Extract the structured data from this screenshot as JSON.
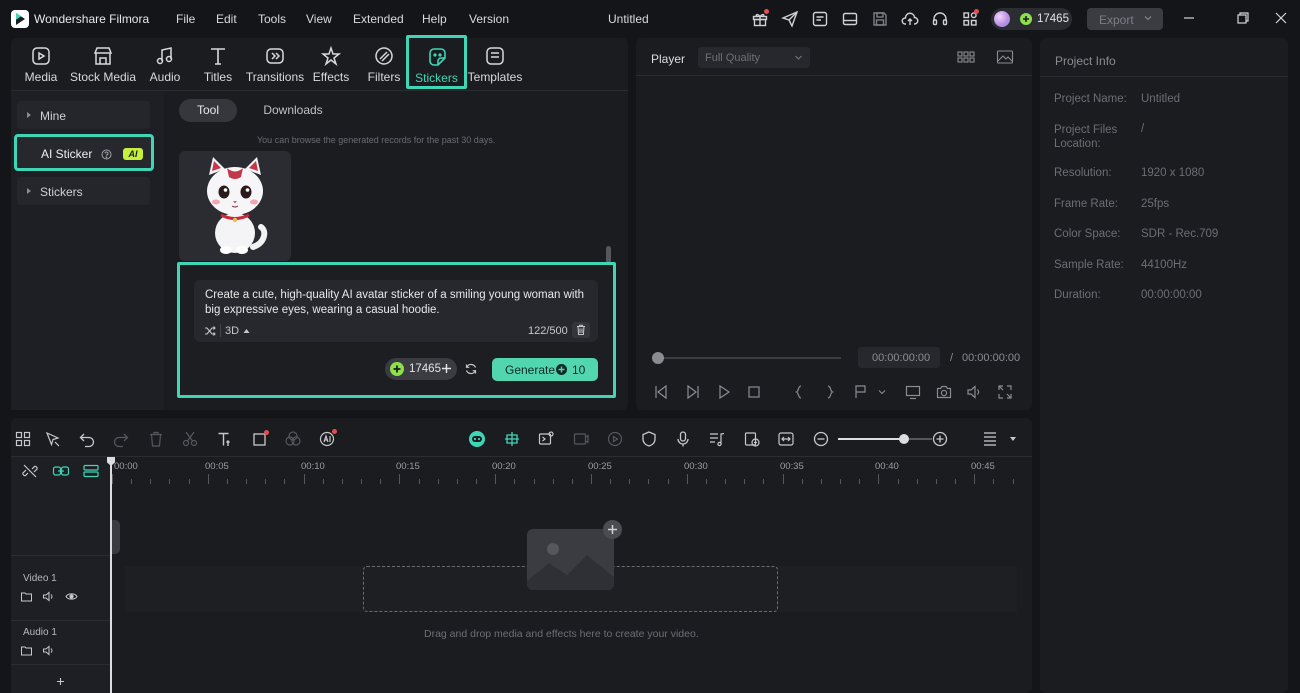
{
  "app": {
    "name": "Wondershare Filmora",
    "document_title": "Untitled"
  },
  "menu": [
    "File",
    "Edit",
    "Tools",
    "View",
    "Extended",
    "Help",
    "Version"
  ],
  "account": {
    "credits": "17465"
  },
  "toolbar": {
    "export_label": "Export"
  },
  "media_tabs": [
    {
      "label": "Media",
      "icon": "media-icon"
    },
    {
      "label": "Stock Media",
      "icon": "stock-media-icon"
    },
    {
      "label": "Audio",
      "icon": "audio-icon"
    },
    {
      "label": "Titles",
      "icon": "titles-icon"
    },
    {
      "label": "Transitions",
      "icon": "transitions-icon"
    },
    {
      "label": "Effects",
      "icon": "effects-icon"
    },
    {
      "label": "Filters",
      "icon": "filters-icon"
    },
    {
      "label": "Stickers",
      "icon": "stickers-icon",
      "active": true
    },
    {
      "label": "Templates",
      "icon": "templates-icon"
    }
  ],
  "sidebar": {
    "items": [
      {
        "label": "Mine"
      },
      {
        "label": "AI Sticker",
        "badge": "AI",
        "active": true
      },
      {
        "label": "Stickers"
      }
    ]
  },
  "sticker_panel": {
    "tabs": [
      "Tool",
      "Downloads"
    ],
    "active_tab": "Tool",
    "notice": "You can browse the generated records for the past 30 days.",
    "prompt_text": "Create a cute, high-quality AI avatar sticker of a smiling young woman with big expressive eyes, wearing a casual hoodie.",
    "style": "3D",
    "char_count": "122/500",
    "credits": "17465",
    "generate_label": "Generate",
    "generate_cost": "10"
  },
  "player": {
    "label": "Player",
    "quality": "Full Quality",
    "current_time": "00:00:00:00",
    "separator": "/",
    "total_time": "00:00:00:00"
  },
  "project_info": {
    "title": "Project Info",
    "rows": [
      {
        "label": "Project Name:",
        "value": "Untitled"
      },
      {
        "label": "Project Files Location:",
        "value": "/"
      },
      {
        "label": "Resolution:",
        "value": "1920 x 1080"
      },
      {
        "label": "Frame Rate:",
        "value": "25fps"
      },
      {
        "label": "Color Space:",
        "value": "SDR - Rec.709"
      },
      {
        "label": "Sample Rate:",
        "value": "44100Hz"
      },
      {
        "label": "Duration:",
        "value": "00:00:00:00"
      }
    ]
  },
  "timeline": {
    "ruler": [
      "00:00",
      "00:05",
      "00:10",
      "00:15",
      "00:20",
      "00:25",
      "00:30",
      "00:35",
      "00:40",
      "00:45"
    ],
    "tracks": [
      {
        "label": "Video 1"
      },
      {
        "label": "Audio 1"
      }
    ],
    "drop_hint": "Drag and drop media and effects here to create your video.",
    "zoom_level": 0.7
  },
  "colors": {
    "accent": "#3fd6b6",
    "generate": "#52d6b0",
    "bg": "#141518",
    "panel": "#1b1c20"
  }
}
